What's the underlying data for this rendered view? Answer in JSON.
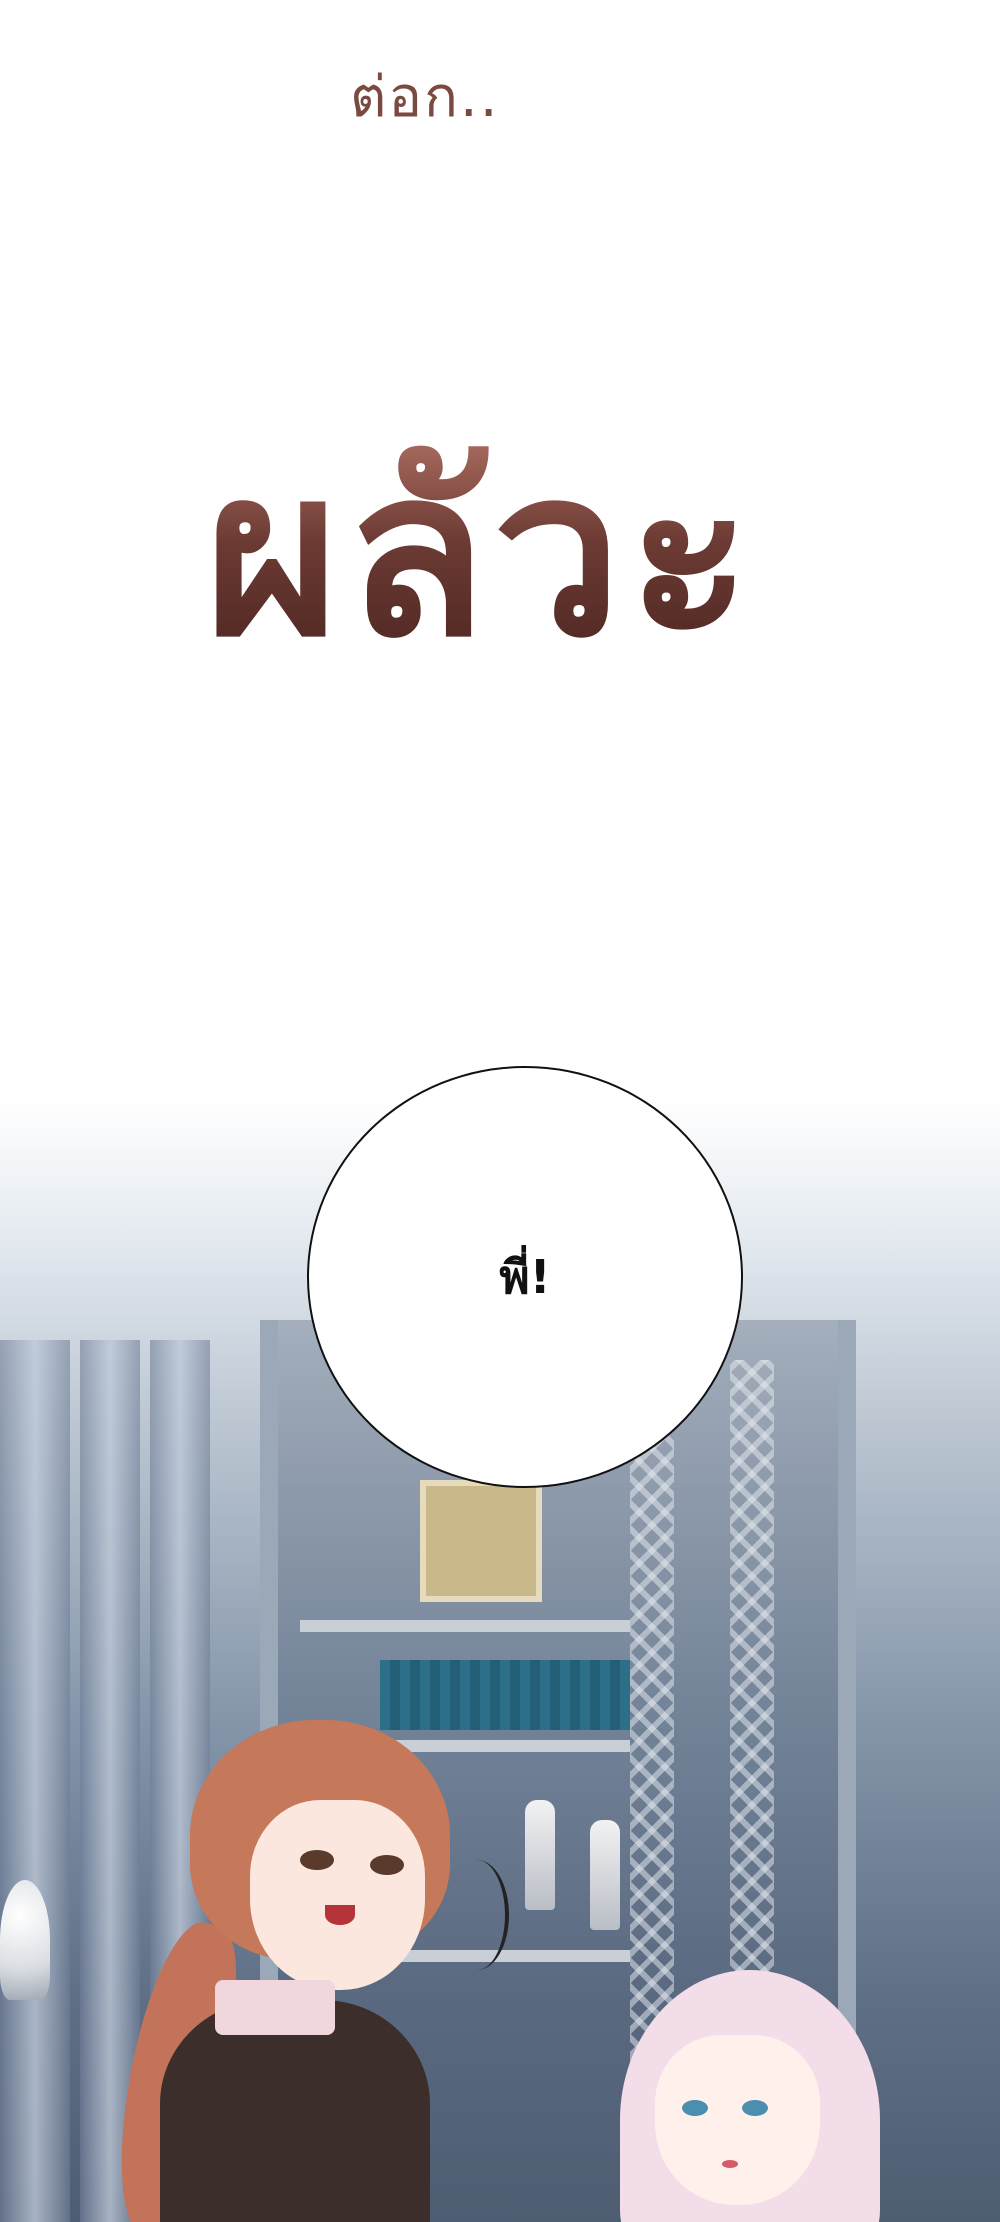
{
  "caption": {
    "small_text": "ต่อก.."
  },
  "sfx": {
    "text": "ผลัวะ"
  },
  "speech_bubble": {
    "text": "พี่!"
  },
  "colors": {
    "sfx": "#5a2e28",
    "caption": "#7a4a40",
    "background": "#ffffff"
  }
}
